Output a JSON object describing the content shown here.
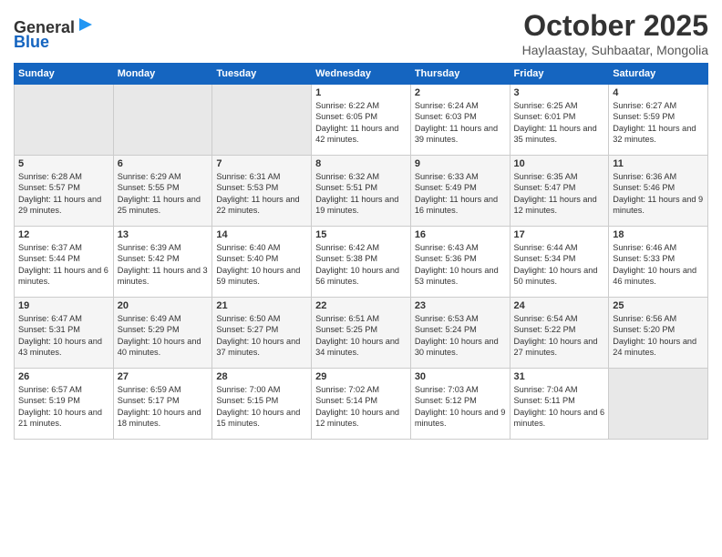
{
  "header": {
    "logo_general": "General",
    "logo_blue": "Blue",
    "month": "October 2025",
    "location": "Haylaastay, Suhbaatar, Mongolia"
  },
  "days_of_week": [
    "Sunday",
    "Monday",
    "Tuesday",
    "Wednesday",
    "Thursday",
    "Friday",
    "Saturday"
  ],
  "weeks": [
    [
      {
        "day": "",
        "empty": true
      },
      {
        "day": "",
        "empty": true
      },
      {
        "day": "",
        "empty": true
      },
      {
        "day": "1",
        "sunrise": "Sunrise: 6:22 AM",
        "sunset": "Sunset: 6:05 PM",
        "daylight": "Daylight: 11 hours and 42 minutes."
      },
      {
        "day": "2",
        "sunrise": "Sunrise: 6:24 AM",
        "sunset": "Sunset: 6:03 PM",
        "daylight": "Daylight: 11 hours and 39 minutes."
      },
      {
        "day": "3",
        "sunrise": "Sunrise: 6:25 AM",
        "sunset": "Sunset: 6:01 PM",
        "daylight": "Daylight: 11 hours and 35 minutes."
      },
      {
        "day": "4",
        "sunrise": "Sunrise: 6:27 AM",
        "sunset": "Sunset: 5:59 PM",
        "daylight": "Daylight: 11 hours and 32 minutes."
      }
    ],
    [
      {
        "day": "5",
        "sunrise": "Sunrise: 6:28 AM",
        "sunset": "Sunset: 5:57 PM",
        "daylight": "Daylight: 11 hours and 29 minutes."
      },
      {
        "day": "6",
        "sunrise": "Sunrise: 6:29 AM",
        "sunset": "Sunset: 5:55 PM",
        "daylight": "Daylight: 11 hours and 25 minutes."
      },
      {
        "day": "7",
        "sunrise": "Sunrise: 6:31 AM",
        "sunset": "Sunset: 5:53 PM",
        "daylight": "Daylight: 11 hours and 22 minutes."
      },
      {
        "day": "8",
        "sunrise": "Sunrise: 6:32 AM",
        "sunset": "Sunset: 5:51 PM",
        "daylight": "Daylight: 11 hours and 19 minutes."
      },
      {
        "day": "9",
        "sunrise": "Sunrise: 6:33 AM",
        "sunset": "Sunset: 5:49 PM",
        "daylight": "Daylight: 11 hours and 16 minutes."
      },
      {
        "day": "10",
        "sunrise": "Sunrise: 6:35 AM",
        "sunset": "Sunset: 5:47 PM",
        "daylight": "Daylight: 11 hours and 12 minutes."
      },
      {
        "day": "11",
        "sunrise": "Sunrise: 6:36 AM",
        "sunset": "Sunset: 5:46 PM",
        "daylight": "Daylight: 11 hours and 9 minutes."
      }
    ],
    [
      {
        "day": "12",
        "sunrise": "Sunrise: 6:37 AM",
        "sunset": "Sunset: 5:44 PM",
        "daylight": "Daylight: 11 hours and 6 minutes."
      },
      {
        "day": "13",
        "sunrise": "Sunrise: 6:39 AM",
        "sunset": "Sunset: 5:42 PM",
        "daylight": "Daylight: 11 hours and 3 minutes."
      },
      {
        "day": "14",
        "sunrise": "Sunrise: 6:40 AM",
        "sunset": "Sunset: 5:40 PM",
        "daylight": "Daylight: 10 hours and 59 minutes."
      },
      {
        "day": "15",
        "sunrise": "Sunrise: 6:42 AM",
        "sunset": "Sunset: 5:38 PM",
        "daylight": "Daylight: 10 hours and 56 minutes."
      },
      {
        "day": "16",
        "sunrise": "Sunrise: 6:43 AM",
        "sunset": "Sunset: 5:36 PM",
        "daylight": "Daylight: 10 hours and 53 minutes."
      },
      {
        "day": "17",
        "sunrise": "Sunrise: 6:44 AM",
        "sunset": "Sunset: 5:34 PM",
        "daylight": "Daylight: 10 hours and 50 minutes."
      },
      {
        "day": "18",
        "sunrise": "Sunrise: 6:46 AM",
        "sunset": "Sunset: 5:33 PM",
        "daylight": "Daylight: 10 hours and 46 minutes."
      }
    ],
    [
      {
        "day": "19",
        "sunrise": "Sunrise: 6:47 AM",
        "sunset": "Sunset: 5:31 PM",
        "daylight": "Daylight: 10 hours and 43 minutes."
      },
      {
        "day": "20",
        "sunrise": "Sunrise: 6:49 AM",
        "sunset": "Sunset: 5:29 PM",
        "daylight": "Daylight: 10 hours and 40 minutes."
      },
      {
        "day": "21",
        "sunrise": "Sunrise: 6:50 AM",
        "sunset": "Sunset: 5:27 PM",
        "daylight": "Daylight: 10 hours and 37 minutes."
      },
      {
        "day": "22",
        "sunrise": "Sunrise: 6:51 AM",
        "sunset": "Sunset: 5:25 PM",
        "daylight": "Daylight: 10 hours and 34 minutes."
      },
      {
        "day": "23",
        "sunrise": "Sunrise: 6:53 AM",
        "sunset": "Sunset: 5:24 PM",
        "daylight": "Daylight: 10 hours and 30 minutes."
      },
      {
        "day": "24",
        "sunrise": "Sunrise: 6:54 AM",
        "sunset": "Sunset: 5:22 PM",
        "daylight": "Daylight: 10 hours and 27 minutes."
      },
      {
        "day": "25",
        "sunrise": "Sunrise: 6:56 AM",
        "sunset": "Sunset: 5:20 PM",
        "daylight": "Daylight: 10 hours and 24 minutes."
      }
    ],
    [
      {
        "day": "26",
        "sunrise": "Sunrise: 6:57 AM",
        "sunset": "Sunset: 5:19 PM",
        "daylight": "Daylight: 10 hours and 21 minutes."
      },
      {
        "day": "27",
        "sunrise": "Sunrise: 6:59 AM",
        "sunset": "Sunset: 5:17 PM",
        "daylight": "Daylight: 10 hours and 18 minutes."
      },
      {
        "day": "28",
        "sunrise": "Sunrise: 7:00 AM",
        "sunset": "Sunset: 5:15 PM",
        "daylight": "Daylight: 10 hours and 15 minutes."
      },
      {
        "day": "29",
        "sunrise": "Sunrise: 7:02 AM",
        "sunset": "Sunset: 5:14 PM",
        "daylight": "Daylight: 10 hours and 12 minutes."
      },
      {
        "day": "30",
        "sunrise": "Sunrise: 7:03 AM",
        "sunset": "Sunset: 5:12 PM",
        "daylight": "Daylight: 10 hours and 9 minutes."
      },
      {
        "day": "31",
        "sunrise": "Sunrise: 7:04 AM",
        "sunset": "Sunset: 5:11 PM",
        "daylight": "Daylight: 10 hours and 6 minutes."
      },
      {
        "day": "",
        "empty": true
      }
    ]
  ]
}
